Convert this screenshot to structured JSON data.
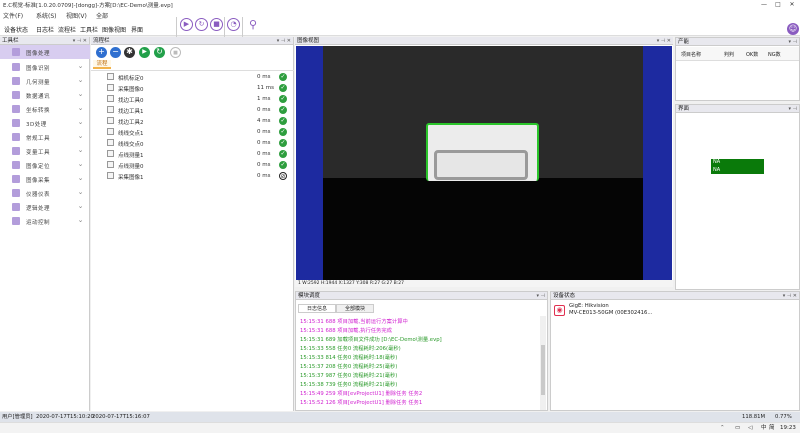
{
  "window": {
    "title": "E.C视觉-标准[1.0.20.0709]-[dongg]-方案[D:\\EC-Demo\\测量.evp]",
    "buttons": [
      "—",
      "□",
      "✕"
    ]
  },
  "menu": [
    "文件(F)",
    "系统(S)",
    "视图(V)",
    "全部"
  ],
  "toolbar": {
    "items": [
      "设备状态",
      "日志栏",
      "流程栏",
      "工具栏",
      "图像视图",
      "界面"
    ],
    "icons": [
      "play-icon",
      "refresh-icon",
      "stop-icon",
      "gauge-icon",
      "user-search-icon"
    ],
    "user_badge": "☺"
  },
  "toolbox": {
    "title": "工具栏",
    "selected": "图像处理",
    "items": [
      "图像处理",
      "图像识别",
      "几何测量",
      "数据通讯",
      "坐标转换",
      "3D处理",
      "常规工具",
      "变量工具",
      "图像定位",
      "图像采集",
      "仪器仪表",
      "逻辑处理",
      "运动控制"
    ]
  },
  "flow": {
    "title": "流程栏",
    "tab": "流程",
    "rows": [
      {
        "name": "相机标定0",
        "ms": "0  ms",
        "status": "ok"
      },
      {
        "name": "采集图像0",
        "ms": "11  ms",
        "status": "ok"
      },
      {
        "name": "找边工具0",
        "ms": "1  ms",
        "status": "ok"
      },
      {
        "name": "找边工具1",
        "ms": "0  ms",
        "status": "ok"
      },
      {
        "name": "找边工具2",
        "ms": "4  ms",
        "status": "ok"
      },
      {
        "name": "线线交点1",
        "ms": "0  ms",
        "status": "ok"
      },
      {
        "name": "线线交点0",
        "ms": "0  ms",
        "status": "ok"
      },
      {
        "name": "点线测量1",
        "ms": "0  ms",
        "status": "ok"
      },
      {
        "name": "点线测量0",
        "ms": "0  ms",
        "status": "ok"
      },
      {
        "name": "采集图像1",
        "ms": "0  ms",
        "status": "none"
      }
    ]
  },
  "image_view": {
    "title": "图像视图",
    "status": "1 W:2592 H:1944 X:1327 Y:308 R:27 G:27 B:27"
  },
  "stats": {
    "title": "产能",
    "headers": [
      "项目名称",
      "判判",
      "OK数",
      "NG数"
    ]
  },
  "ui_panel": {
    "title": "界面",
    "na1": "NA",
    "na2": "NA"
  },
  "log": {
    "title": "模块调度",
    "tabs": [
      "日志信息",
      "全部模块"
    ],
    "lines": [
      {
        "time": "15:15:31 688",
        "text": "项目加载,当前运行方案计算中",
        "color": "#d020d0"
      },
      {
        "time": "15:15:31 688",
        "text": "项目加载,执行任务完成",
        "color": "#d020d0"
      },
      {
        "time": "15:15:31 689",
        "text": "加载项目文件成功 [D:\\EC-Demo\\测量.evp]",
        "color": "#2a9a2a"
      },
      {
        "time": "15:15:33 558",
        "text": "任务0 流程耗时:206(毫秒)",
        "color": "#2a9a2a"
      },
      {
        "time": "15:15:33 814",
        "text": "任务0 流程耗时:18(毫秒)",
        "color": "#2a9a2a"
      },
      {
        "time": "15:15:37 208",
        "text": "任务0 流程耗时:25(毫秒)",
        "color": "#2a9a2a"
      },
      {
        "time": "15:15:37 987",
        "text": "任务0 流程耗时:21(毫秒)",
        "color": "#2a9a2a"
      },
      {
        "time": "15:15:38 739",
        "text": "任务0 流程耗时:21(毫秒)",
        "color": "#2a9a2a"
      },
      {
        "time": "15:15:49 259",
        "text": "项目[evProjectU1] 删除任务 任务2",
        "color": "#d020d0"
      },
      {
        "time": "15:15:52 126",
        "text": "项目[evProjectU1] 删除任务 任务1",
        "color": "#d020d0"
      }
    ]
  },
  "device": {
    "title": "设备状态",
    "name": "GigE: Hikvision",
    "model": "MV-CE013-50GM (00E302416..."
  },
  "statusbar": {
    "user": "用户[管理员]",
    "date1": "2020-07-17T15:10:20",
    "date2": "2020-07-17T15:16:07",
    "memory": "118.81M",
    "cpu": "0.77%"
  },
  "taskbar": {
    "ime": "中",
    "lang": "简",
    "time": "19:23"
  },
  "colors": {
    "accent": "#8a5cc0",
    "ok": "#2e9e3e",
    "blue": "#1d2aa0",
    "na_green": "#0a7a0a"
  }
}
